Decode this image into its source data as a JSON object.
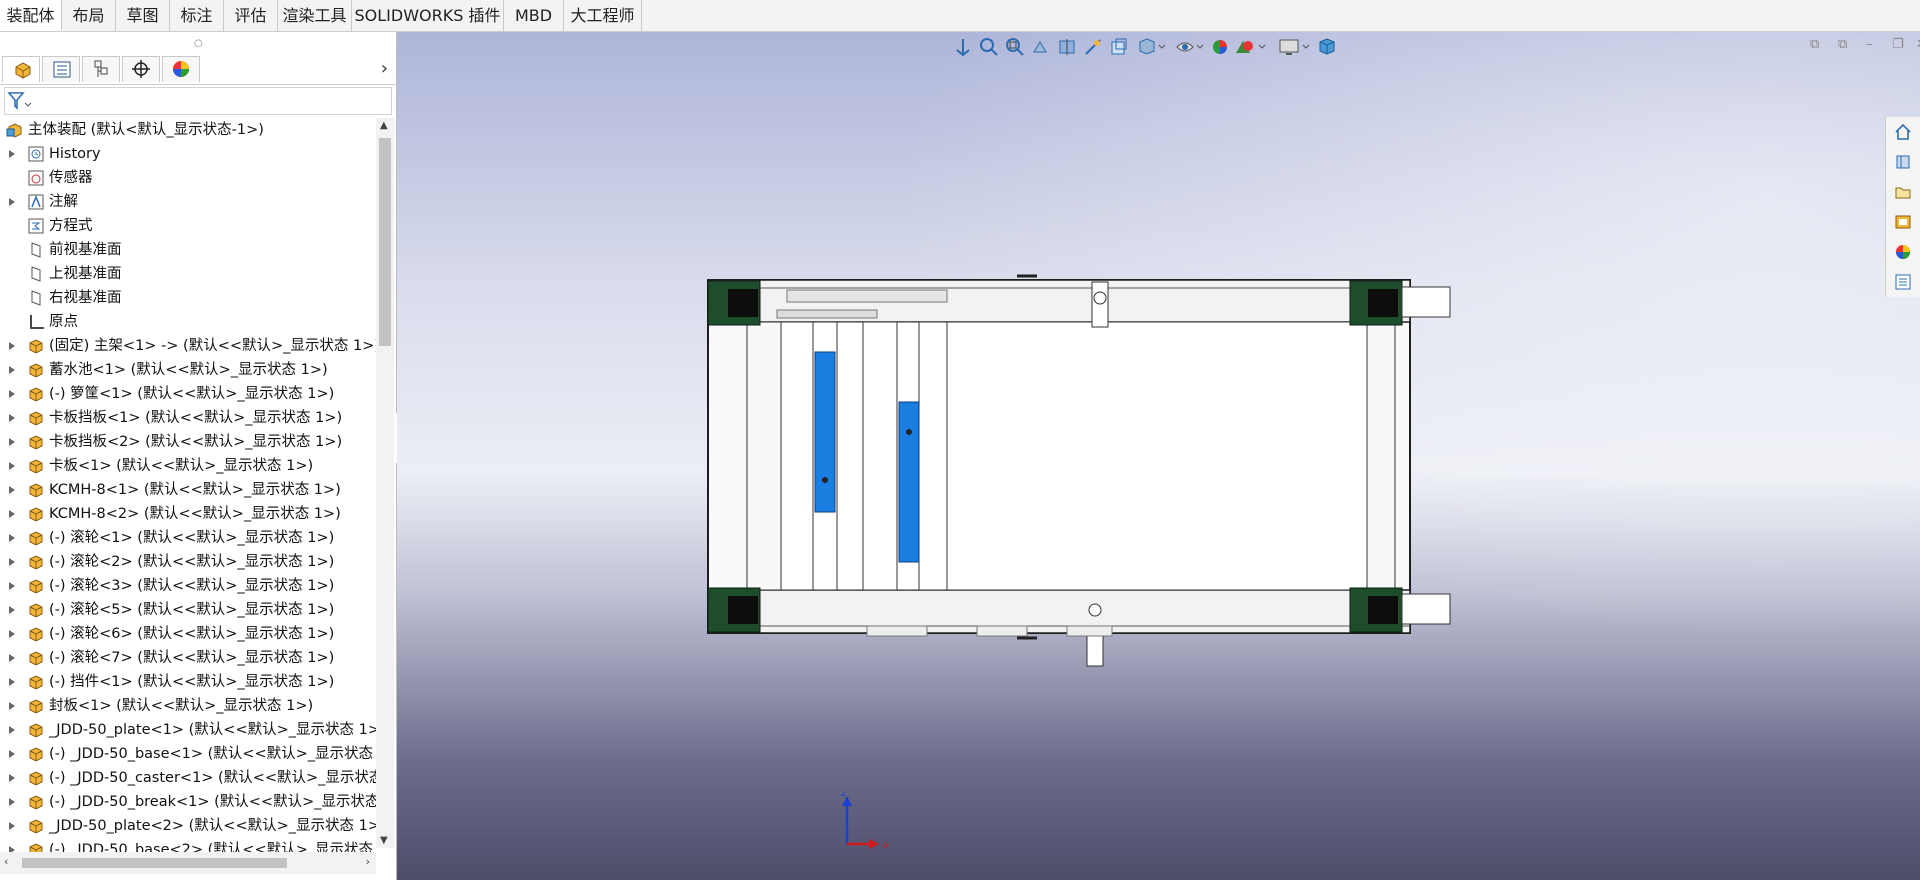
{
  "tabs": [
    "装配体",
    "布局",
    "草图",
    "标注",
    "评估",
    "渲染工具",
    "SOLIDWORKS 插件",
    "MBD",
    "大工程师"
  ],
  "active_tab": "装配体",
  "feature_tree": {
    "root": "主体装配  (默认<默认_显示状态-1>)",
    "items": [
      {
        "label": "History",
        "icon": "history-icon",
        "expandable": true
      },
      {
        "label": "传感器",
        "icon": "sensor-icon",
        "expandable": false
      },
      {
        "label": "注解",
        "icon": "annotation-icon",
        "expandable": true
      },
      {
        "label": "方程式",
        "icon": "equation-icon",
        "expandable": false
      },
      {
        "label": "前视基准面",
        "icon": "plane-icon",
        "expandable": false
      },
      {
        "label": "上视基准面",
        "icon": "plane-icon",
        "expandable": false
      },
      {
        "label": "右视基准面",
        "icon": "plane-icon",
        "expandable": false
      },
      {
        "label": "原点",
        "icon": "origin-icon",
        "expandable": false
      },
      {
        "label": "(固定) 主架<1> -> (默认<<默认>_显示状态 1>)",
        "icon": "assembly-icon",
        "expandable": true
      },
      {
        "label": "蓄水池<1> (默认<<默认>_显示状态 1>)",
        "icon": "assembly-icon",
        "expandable": true
      },
      {
        "label": "(-) 箩筐<1> (默认<<默认>_显示状态 1>)",
        "icon": "assembly-icon",
        "expandable": true
      },
      {
        "label": "卡板挡板<1> (默认<<默认>_显示状态 1>)",
        "icon": "assembly-icon",
        "expandable": true
      },
      {
        "label": "卡板挡板<2> (默认<<默认>_显示状态 1>)",
        "icon": "assembly-icon",
        "expandable": true
      },
      {
        "label": "卡板<1> (默认<<默认>_显示状态 1>)",
        "icon": "assembly-icon",
        "expandable": true
      },
      {
        "label": "KCMH-8<1> (默认<<默认>_显示状态 1>)",
        "icon": "assembly-icon",
        "expandable": true
      },
      {
        "label": "KCMH-8<2> (默认<<默认>_显示状态 1>)",
        "icon": "assembly-icon",
        "expandable": true
      },
      {
        "label": "(-) 滚轮<1> (默认<<默认>_显示状态 1>)",
        "icon": "assembly-icon",
        "expandable": true
      },
      {
        "label": "(-) 滚轮<2> (默认<<默认>_显示状态 1>)",
        "icon": "assembly-icon",
        "expandable": true
      },
      {
        "label": "(-) 滚轮<3> (默认<<默认>_显示状态 1>)",
        "icon": "assembly-icon",
        "expandable": true
      },
      {
        "label": "(-) 滚轮<5> (默认<<默认>_显示状态 1>)",
        "icon": "assembly-icon",
        "expandable": true
      },
      {
        "label": "(-) 滚轮<6> (默认<<默认>_显示状态 1>)",
        "icon": "assembly-icon",
        "expandable": true
      },
      {
        "label": "(-) 滚轮<7> (默认<<默认>_显示状态 1>)",
        "icon": "assembly-icon",
        "expandable": true
      },
      {
        "label": "(-) 挡件<1> (默认<<默认>_显示状态 1>)",
        "icon": "assembly-icon",
        "expandable": true
      },
      {
        "label": "封板<1> (默认<<默认>_显示状态 1>)",
        "icon": "assembly-icon",
        "expandable": true
      },
      {
        "label": "_JDD-50_plate<1> (默认<<默认>_显示状态 1>",
        "icon": "assembly-icon",
        "expandable": true
      },
      {
        "label": "(-) _JDD-50_base<1> (默认<<默认>_显示状态",
        "icon": "assembly-icon",
        "expandable": true
      },
      {
        "label": "(-) _JDD-50_caster<1> (默认<<默认>_显示状态",
        "icon": "assembly-icon",
        "expandable": true
      },
      {
        "label": "(-) _JDD-50_break<1> (默认<<默认>_显示状态",
        "icon": "assembly-icon",
        "expandable": true
      },
      {
        "label": "_JDD-50_plate<2> (默认<<默认>_显示状态 1>",
        "icon": "assembly-icon",
        "expandable": true
      },
      {
        "label": "(-) _JDD-50_base<2> (默认<<默认>_显示状态",
        "icon": "assembly-icon",
        "expandable": true
      }
    ]
  },
  "triad": {
    "z": "z",
    "x": "x"
  },
  "colors": {
    "frame": "#1f1f1f",
    "blue_part": "#1a7de0",
    "caster": "#1e4d2b",
    "tree_icon": "#e8b43a"
  }
}
